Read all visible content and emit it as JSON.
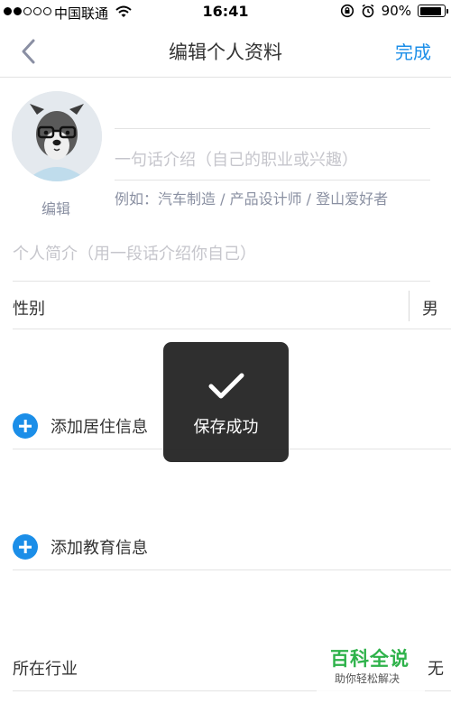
{
  "status_bar": {
    "carrier": "中国联通",
    "time": "16:41",
    "battery": "90%",
    "battery_level": 0.9
  },
  "nav": {
    "back_icon": "chevron-left-icon",
    "title": "编辑个人资料",
    "done_label": "完成"
  },
  "profile": {
    "avatar_edit_label": "编辑",
    "intro_placeholder": "一句话介绍（自己的职业或兴趣）",
    "intro_example": "例如：汽车制造 / 产品设计师 / 登山爱好者",
    "bio_placeholder": "个人简介（用一段话介绍你自己）"
  },
  "gender": {
    "label": "性别",
    "value": "男"
  },
  "residence": {
    "add_label": "添加居住信息"
  },
  "education": {
    "add_label": "添加教育信息"
  },
  "industry": {
    "label": "所在行业",
    "value_partial": "无"
  },
  "toast": {
    "message": "保存成功"
  },
  "watermark": {
    "title": "百科全说",
    "subtitle": "助你轻松解决"
  },
  "colors": {
    "accent": "#1b8ee8",
    "placeholder": "#c6c6cc",
    "hint": "#8a90a2",
    "toast_bg": "#262626",
    "watermark": "#2eb24a"
  }
}
